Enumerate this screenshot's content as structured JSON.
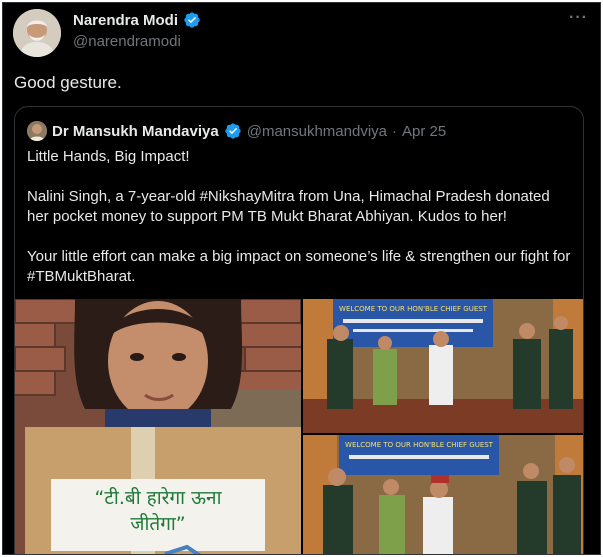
{
  "author": {
    "name": "Narendra Modi",
    "handle": "@narendramodi",
    "avatar_icon": "profile-photo",
    "verified_color": "#1d9bf0"
  },
  "menu_icon": "more-horizontal-icon",
  "tweet": {
    "text": "Good gesture."
  },
  "quoted": {
    "name": "Dr Mansukh Mandaviya",
    "handle": "@mansukhmandviya",
    "separator": "·",
    "date": "Apr 25",
    "paragraphs": [
      "Little Hands, Big Impact!",
      "Nalini Singh, a 7-year-old #NikshayMitra from Una, Himachal Pradesh donated her pocket money to support PM TB Mukt Bharat Abhiyan. Kudos to her!",
      "Your little effort can make a big impact on someone’s life & strengthen our fight for #TBMuktBharat."
    ],
    "sign_text": "“टी.बी हारेगा ऊना\nजीतेगा”",
    "banner_text": "WELCOME TO OUR HON'BLE CHIEF GUEST"
  },
  "colors": {
    "background": "#000000",
    "text": "#e7e9ea",
    "muted": "#71767b",
    "border": "#2f3336",
    "accent": "#1d9bf0"
  }
}
